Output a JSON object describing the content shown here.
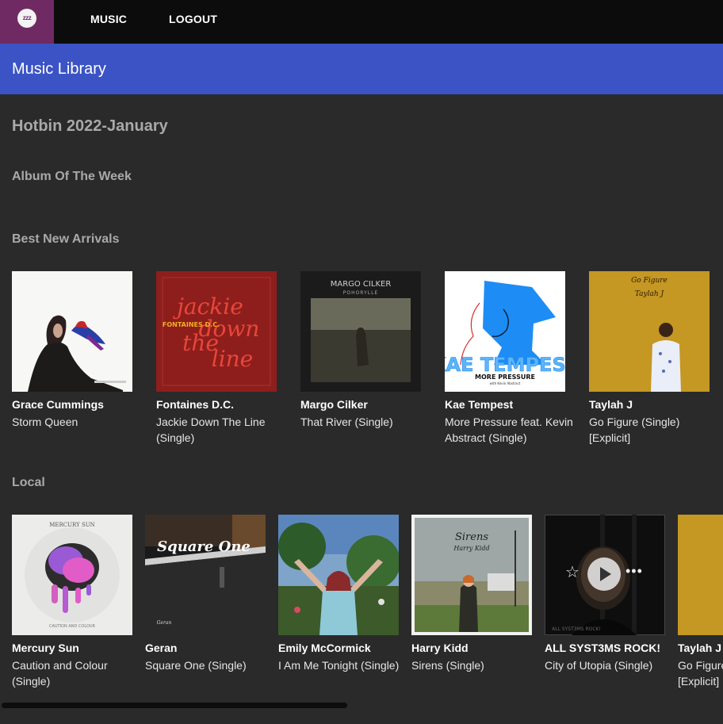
{
  "nav": {
    "logo_text": "zzz",
    "music": "MUSIC",
    "logout": "LOGOUT"
  },
  "appbar": {
    "title": "Music Library"
  },
  "page": {
    "heading": "Hotbin 2022-January"
  },
  "sections": {
    "album_of_week": "Album Of The Week",
    "best_new": "Best New Arrivals",
    "local": "Local"
  },
  "best_new": [
    {
      "artist": "Grace Cummings",
      "album": "Storm Queen"
    },
    {
      "artist": "Fontaines D.C.",
      "album": "Jackie Down The Line (Single)",
      "cover_band": "FONTAINES D.C.",
      "cover_title": "jackie down the line"
    },
    {
      "artist": "Margo Cilker",
      "album": "That River (Single)",
      "cover_artist": "MARGO CILKER",
      "cover_title": "POHORYLLE"
    },
    {
      "artist": "Kae Tempest",
      "album": "More Pressure feat. Kevin Abstract (Single)",
      "cover_artist": "KAE TEMPEST",
      "cover_title": "MORE PRESSURE",
      "cover_sub": "with Kevin Abstract"
    },
    {
      "artist": "Taylah J",
      "album": "Go Figure (Single) [Explicit]",
      "cover_title": "Go Figure",
      "cover_artist": "Taylah J"
    }
  ],
  "local": [
    {
      "artist": "Mercury Sun",
      "album": "Caution and Colour (Single)",
      "cover_artist": "MERCURY SUN",
      "cover_title": "CAUTION AND COLOUR"
    },
    {
      "artist": "Geran",
      "album": "Square One (Single)",
      "cover_title": "Square One",
      "cover_artist": "Geran"
    },
    {
      "artist": "Emily McCormick",
      "album": "I Am Me Tonight (Single)"
    },
    {
      "artist": "Harry Kidd",
      "album": "Sirens (Single)",
      "cover_title": "Sirens",
      "cover_artist": "Harry Kidd"
    },
    {
      "artist": "ALL SYST3MS ROCK!",
      "album": "City of Utopia (Single)",
      "cover_artist": "ALL SYST3MS ROCK!"
    },
    {
      "artist": "Taylah J",
      "album": "Go Figure (Single) [Explicit]"
    }
  ],
  "colors": {
    "topbar": "#0c0c0c",
    "logo_bg": "#6f2a64",
    "appbar": "#3b53c4",
    "background": "#2a2a2a",
    "heading": "#a9a9a9"
  },
  "icons": {
    "logo": "zzz-logo-icon",
    "star": "star-icon",
    "play": "play-icon",
    "more": "more-icon"
  }
}
